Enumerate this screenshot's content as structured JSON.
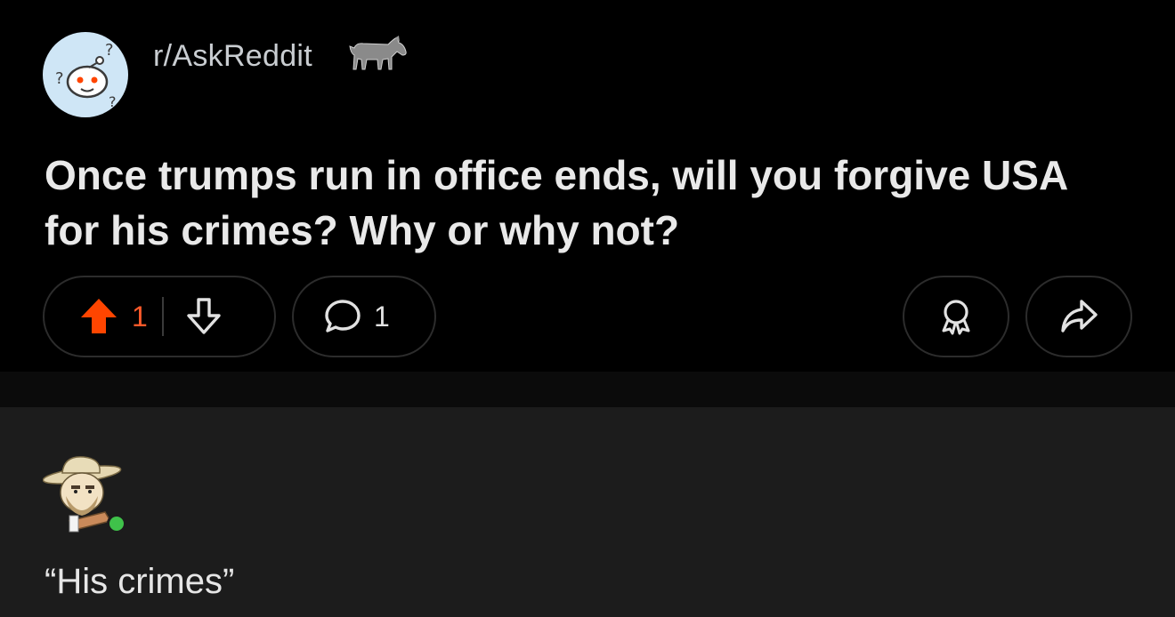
{
  "post": {
    "subreddit": "r/AskReddit",
    "title": "Once trumps run in office ends, will you forgive USA for his crimes? Why or why not?",
    "upvote_count": "1",
    "comment_count": "1"
  },
  "comment": {
    "text": "“His crimes”"
  },
  "colors": {
    "upvote_active": "#ff4500",
    "online": "#3fc24a",
    "subreddit_avatar_bg": "#cfe6f6"
  },
  "icons": {
    "subreddit": "askreddit-snoo-icon",
    "flair": "donkey-icon",
    "upvote": "arrow-up-icon",
    "downvote": "arrow-down-icon",
    "comments": "speech-bubble-icon",
    "award": "award-icon",
    "share": "share-arrow-icon"
  }
}
